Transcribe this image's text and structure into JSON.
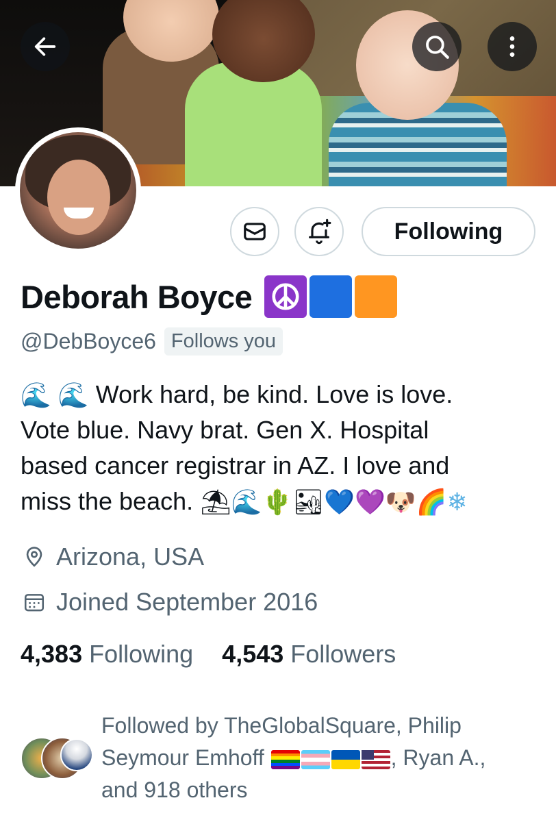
{
  "header": {
    "back_icon": "arrow-left-icon",
    "search_icon": "search-icon",
    "more_icon": "more-vertical-icon"
  },
  "actions": {
    "message_icon": "envelope-icon",
    "notify_icon": "bell-plus-icon",
    "following_label": "Following"
  },
  "profile": {
    "display_name": "Deborah Boyce",
    "name_emojis": [
      "peace-symbol",
      "blue-square",
      "orange-square"
    ],
    "handle": "@DebBoyce6",
    "follows_you": "Follows you",
    "bio_lines": [
      "Work hard, be kind. Love is love.",
      "Vote blue. Navy brat. Gen X. Hospital",
      "based cancer registrar in AZ. I love and",
      "miss the beach."
    ],
    "bio_leading_emojis": [
      "water-wave",
      "water-wave"
    ],
    "bio_trailing_emojis": [
      "beach-umbrella",
      "water-wave",
      "cactus",
      "desert",
      "blue-heart",
      "purple-heart",
      "dog-face",
      "rainbow",
      "snowflake"
    ],
    "location": "Arizona, USA",
    "location_icon": "location-pin-icon",
    "joined": "Joined September 2016",
    "joined_icon": "calendar-icon"
  },
  "stats": {
    "following_count": "4,383",
    "following_label": "Following",
    "followers_count": "4,543",
    "followers_label": "Followers"
  },
  "followed_by": {
    "line1": "Followed by TheGlobalSquare, Philip",
    "line2_name": "Seymour Emhoff",
    "line2_flags": [
      "rainbow-flag",
      "transgender-flag",
      "ukraine-flag",
      "us-flag"
    ],
    "line2_rest": ", Ryan A.,",
    "line3": "and 918 others"
  },
  "colors": {
    "text_primary": "#0f1419",
    "text_secondary": "#536471",
    "border": "#cfd9de",
    "badge_bg": "#eff3f4"
  }
}
